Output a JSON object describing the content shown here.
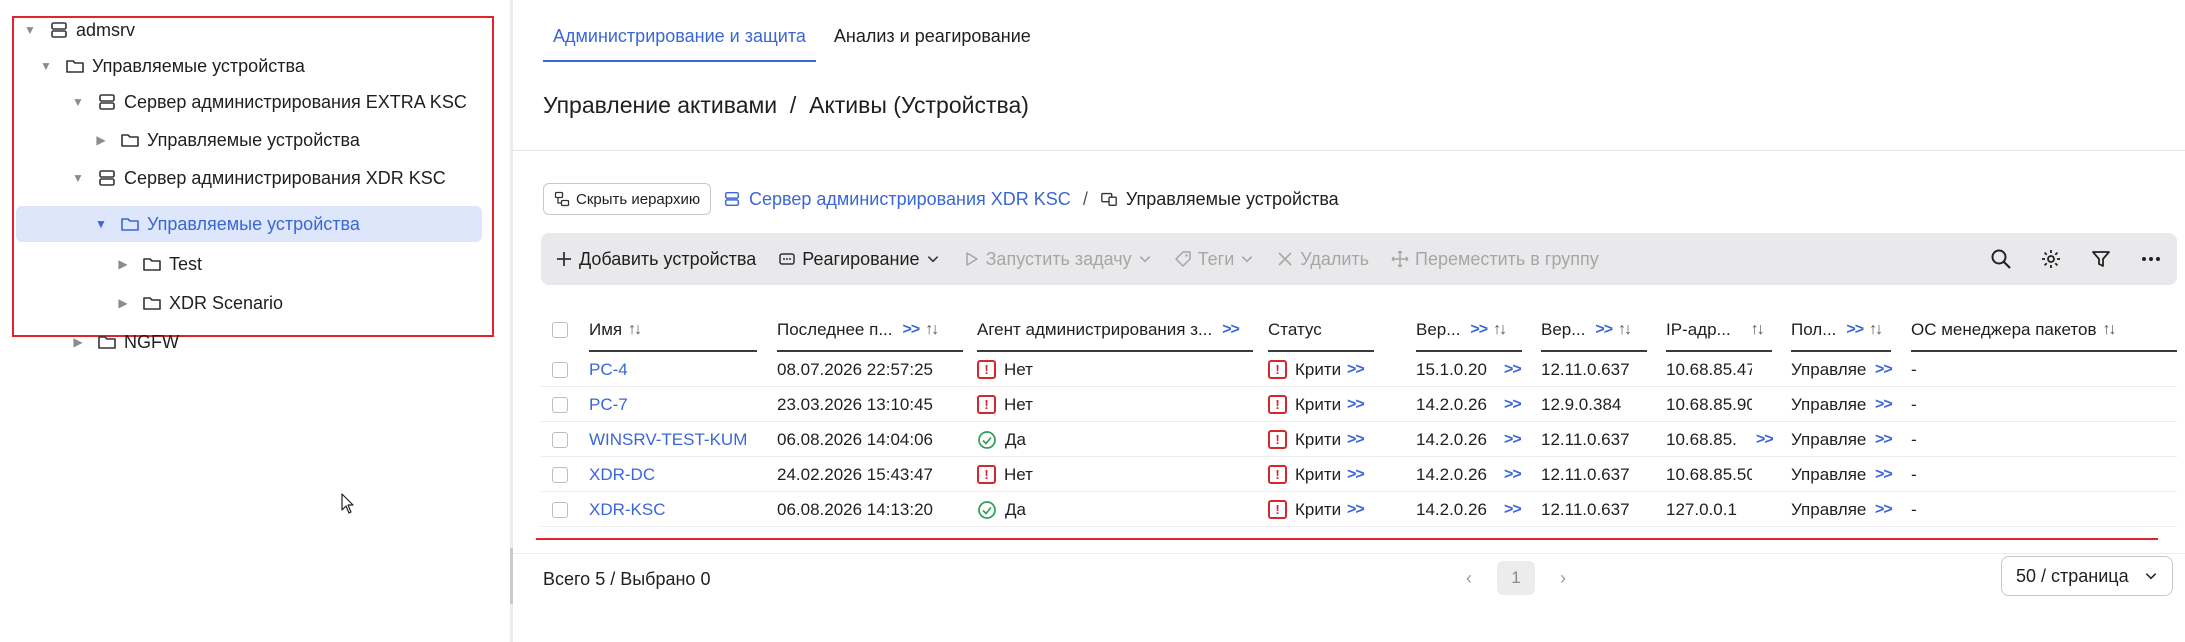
{
  "tree": {
    "nodes": [
      {
        "label": "admsrv",
        "expanded": true,
        "icon": "server-icon"
      },
      {
        "label": "Управляемые устройства",
        "expanded": true,
        "icon": "folder-icon"
      },
      {
        "label": "Сервер администрирования EXTRA KSC",
        "expanded": true,
        "icon": "server-icon"
      },
      {
        "label": "Управляемые устройства",
        "expanded": false,
        "icon": "folder-icon"
      },
      {
        "label": "Сервер администрирования XDR KSC",
        "expanded": true,
        "icon": "server-icon"
      },
      {
        "label": "Управляемые устройства",
        "expanded": true,
        "icon": "folder-icon",
        "selected": true
      },
      {
        "label": "Test",
        "expanded": false,
        "icon": "folder-icon"
      },
      {
        "label": "XDR Scenario",
        "expanded": false,
        "icon": "folder-icon"
      },
      {
        "label": "NGFW",
        "expanded": false,
        "icon": "folder-icon"
      }
    ]
  },
  "tabs": [
    {
      "label": "Администрирование и защита",
      "active": true
    },
    {
      "label": "Анализ и реагирование",
      "active": false
    }
  ],
  "page": {
    "title": "Управление активами  /  Активы (Устройства)"
  },
  "breadcrumbs": {
    "hide_button": "Скрыть иерархию",
    "server": "Сервер администрирования XDR KSC",
    "separator": "/",
    "current": "Управляемые устройства"
  },
  "toolbar": {
    "add": "Добавить устройства",
    "respond": "Реагирование",
    "run_task": "Запустить задачу",
    "tags": "Теги",
    "delete": "Удалить",
    "move": "Переместить в группу"
  },
  "table": {
    "columns": [
      {
        "label": "Имя"
      },
      {
        "label": "Последнее п..."
      },
      {
        "label": "Агент администрирования з..."
      },
      {
        "label": "Статус"
      },
      {
        "label": "Вер..."
      },
      {
        "label": "Вер..."
      },
      {
        "label": "IP-адр..."
      },
      {
        "label": "Пол..."
      },
      {
        "label": "ОС менеджера пакетов"
      }
    ],
    "rows": [
      {
        "name": "PC-4",
        "last": "08.07.2026 22:57:25",
        "agent": "Нет",
        "agent_ok": false,
        "status": "Крити",
        "ver1": "15.1.0.20",
        "ver2": "12.11.0.637",
        "ip": "10.68.85.47",
        "user": "Управляе",
        "os": "-"
      },
      {
        "name": "PC-7",
        "last": "23.03.2026 13:10:45",
        "agent": "Нет",
        "agent_ok": false,
        "status": "Крити",
        "ver1": "14.2.0.26",
        "ver2": "12.9.0.384",
        "ip": "10.68.85.90",
        "user": "Управляе",
        "os": "-"
      },
      {
        "name": "WINSRV-TEST-KUM",
        "last": "06.08.2026 14:04:06",
        "agent": "Да",
        "agent_ok": true,
        "status": "Крити",
        "ver1": "14.2.0.26",
        "ver2": "12.11.0.637",
        "ip": "10.68.85.",
        "user": "Управляе",
        "os": "-"
      },
      {
        "name": "XDR-DC",
        "last": "24.02.2026 15:43:47",
        "agent": "Нет",
        "agent_ok": false,
        "status": "Крити",
        "ver1": "14.2.0.26",
        "ver2": "12.11.0.637",
        "ip": "10.68.85.50",
        "user": "Управляе",
        "os": "-"
      },
      {
        "name": "XDR-KSC",
        "last": "06.08.2026 14:13:20",
        "agent": "Да",
        "agent_ok": true,
        "status": "Крити",
        "ver1": "14.2.0.26",
        "ver2": "12.11.0.637",
        "ip": "127.0.0.1",
        "user": "Управляе",
        "os": "-"
      }
    ],
    "more_marker": ">>",
    "sort_marker": "↑↓"
  },
  "footer": {
    "total": "Всего 5 / Выбрано 0",
    "page": "1",
    "page_size": "50 / страница"
  },
  "colors": {
    "accent": "#3a67d6",
    "critical": "#d6262e",
    "ok": "#2e9e59",
    "highlight_frame": "#e0242b"
  }
}
